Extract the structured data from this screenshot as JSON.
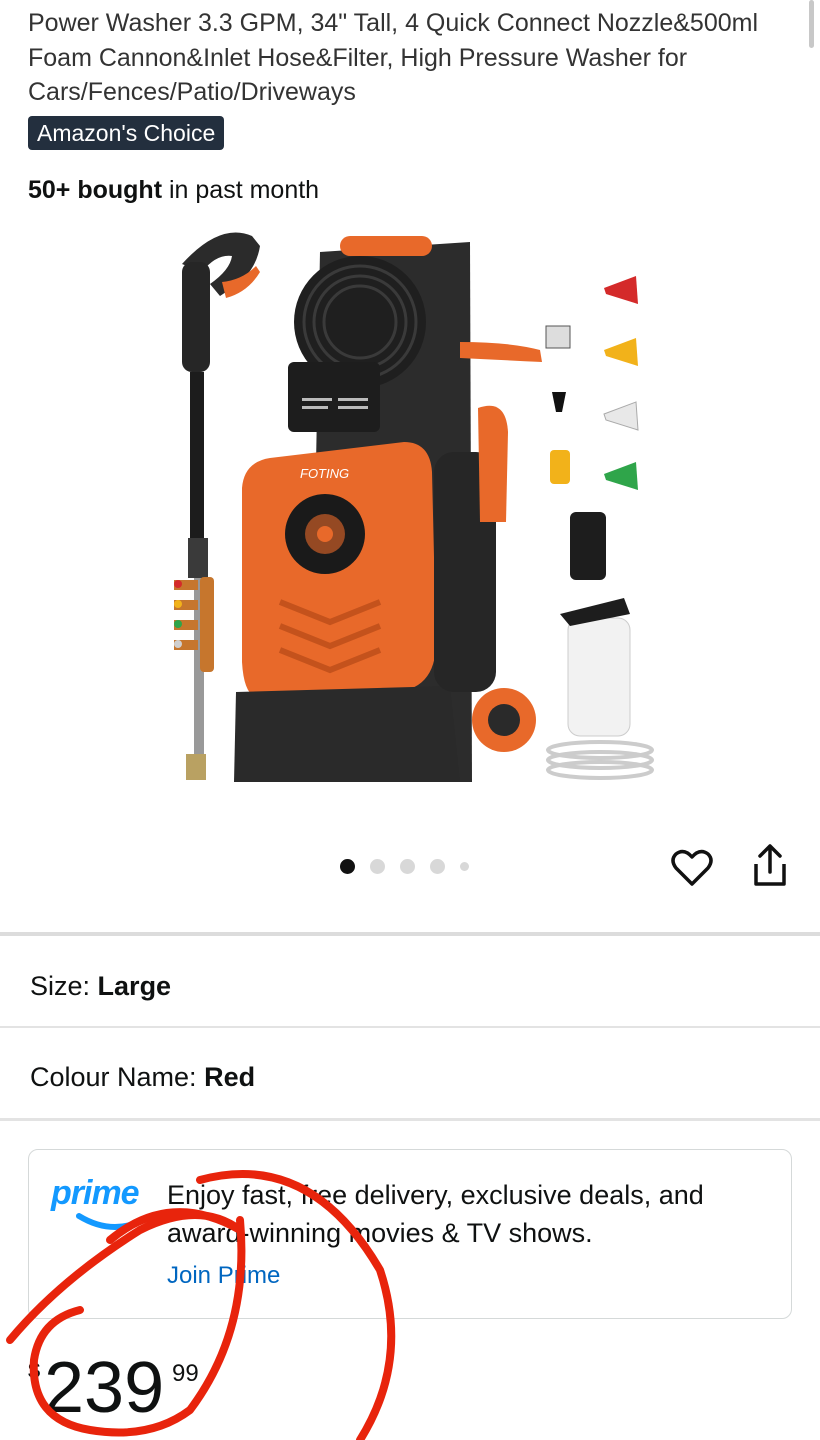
{
  "product": {
    "title": "Power Washer 3.3 GPM, 34\" Tall, 4 Quick Connect Nozzle&500ml Foam Cannon&Inlet Hose&Filter, High Pressure Washer for Cars/Fences/Patio/Driveways",
    "badge": "Amazon's Choice",
    "bought_count": "50+ bought",
    "bought_suffix": "in past month",
    "image_brand_text": "FOTING"
  },
  "gallery": {
    "dots": 5,
    "active_index": 0
  },
  "options": {
    "size_label": "Size:",
    "size_value": "Large",
    "colour_label": "Colour Name:",
    "colour_value": "Red"
  },
  "prime": {
    "logo": "prime",
    "text": "Enjoy fast, free delivery, exclusive deals, and award-winning movies & TV shows.",
    "join_label": "Join Prime"
  },
  "price": {
    "currency": "$",
    "whole": "239",
    "fraction": "99"
  },
  "colors": {
    "badge_bg": "#232f3e",
    "link": "#0066c0",
    "prime_blue": "#1399ff",
    "annotation_red": "#e8240c",
    "product_orange": "#e8692a"
  }
}
